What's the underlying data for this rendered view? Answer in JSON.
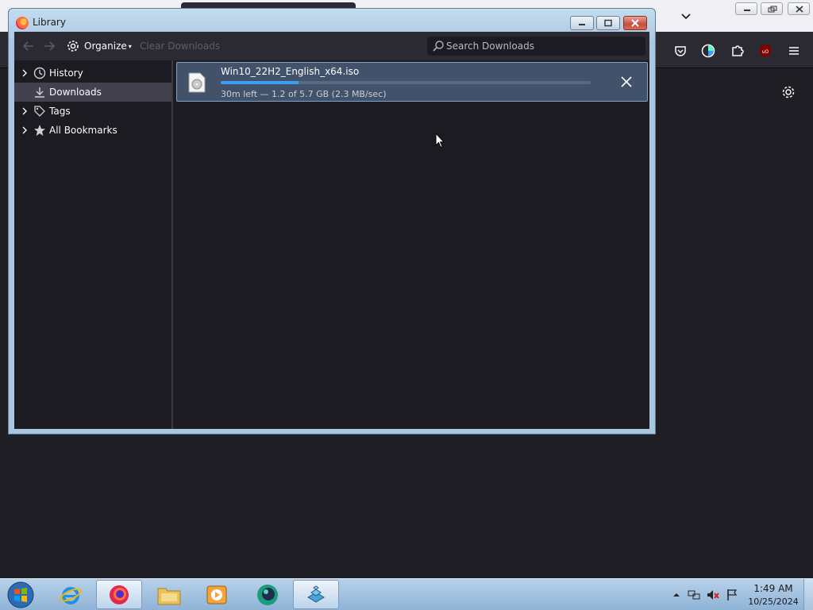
{
  "library": {
    "title": "Library",
    "toolbar": {
      "organize_label": "Organize",
      "clear_downloads_label": "Clear Downloads",
      "search_placeholder": "Search Downloads",
      "search_value": ""
    },
    "sidebar": {
      "items": [
        {
          "label": "History",
          "icon": "clock-icon",
          "selected": false
        },
        {
          "label": "Downloads",
          "icon": "download-icon",
          "selected": true
        },
        {
          "label": "Tags",
          "icon": "tag-icon",
          "selected": false
        },
        {
          "label": "All Bookmarks",
          "icon": "star-icon",
          "selected": false
        }
      ]
    },
    "downloads": [
      {
        "filename": "Win10_22H2_English_x64.iso",
        "status": "30m left — 1.2 of 5.7 GB (2.3 MB/sec)",
        "progress": 0.21,
        "icon": "disc-image-file-icon"
      }
    ]
  },
  "taskbar": {
    "apps": [
      "internet-explorer",
      "firefox",
      "file-explorer",
      "media-player",
      "app-green-orb",
      "app-blocks"
    ],
    "active_app": "firefox",
    "clock_time": "1:49 AM",
    "clock_date": "10/25/2024"
  },
  "colors": {
    "accent": "#3d9ff0",
    "toolbar_bg": "#2b2a33",
    "content_bg": "#1c1b22"
  }
}
